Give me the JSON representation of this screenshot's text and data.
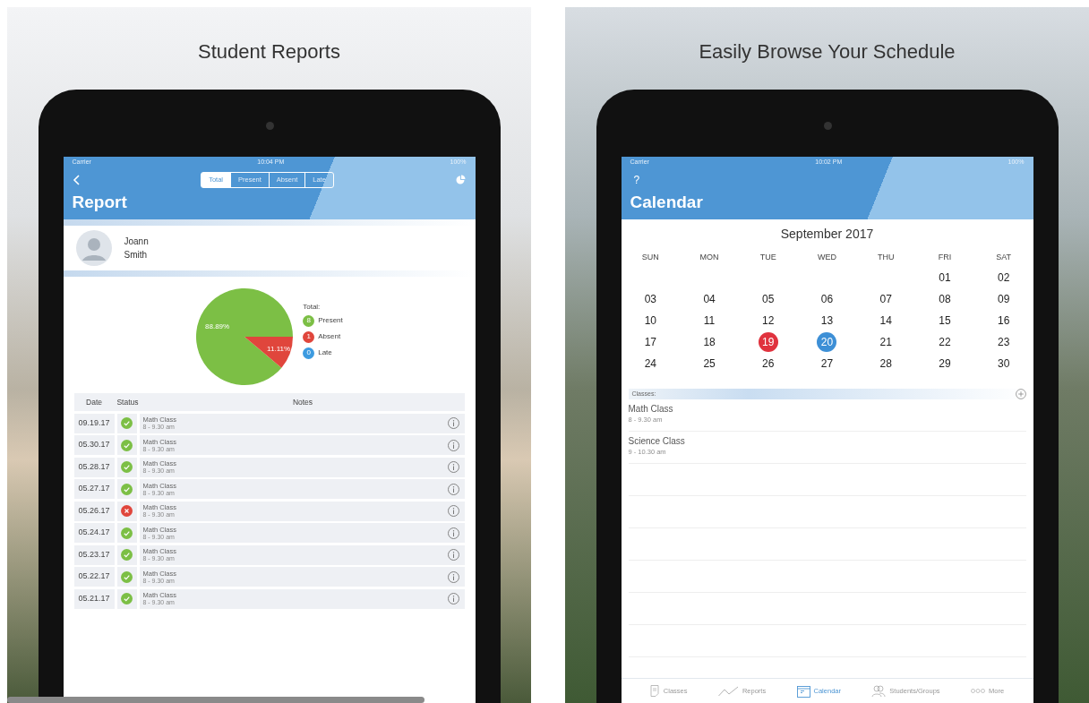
{
  "panels": [
    {
      "kind": "report",
      "headline": "Student Reports",
      "status_bar": {
        "carrier": "Carrier",
        "time": "10:04 PM",
        "battery": "100%"
      },
      "segments": [
        {
          "label": "Total",
          "selected": true
        },
        {
          "label": "Present",
          "selected": false
        },
        {
          "label": "Absent",
          "selected": false
        },
        {
          "label": "Late",
          "selected": false
        }
      ],
      "title": "Report",
      "student": {
        "first_name": "Joann",
        "last_name": "Smith"
      },
      "chart_data": {
        "type": "pie",
        "title": "Total:",
        "categories": [
          "Present",
          "Absent",
          "Late"
        ],
        "values": [
          88.89,
          11.11,
          0
        ],
        "colors": [
          "#7cbf45",
          "#e0463c",
          "#3d9be0"
        ],
        "value_labels": [
          "88.89%",
          "11.11%",
          null
        ]
      },
      "legend_counts": [
        "8",
        "1",
        "0"
      ],
      "table": {
        "columns": [
          "Date",
          "Status",
          "Notes"
        ],
        "rows": [
          {
            "date": "09.19.17",
            "kind": "present",
            "note": "Math Class",
            "time": "8 - 9.30 am"
          },
          {
            "date": "05.30.17",
            "kind": "present",
            "note": "Math Class",
            "time": "8 - 9.30 am"
          },
          {
            "date": "05.28.17",
            "kind": "present",
            "note": "Math Class",
            "time": "8 - 9.30 am"
          },
          {
            "date": "05.27.17",
            "kind": "present",
            "note": "Math Class",
            "time": "8 - 9.30 am"
          },
          {
            "date": "05.26.17",
            "kind": "absent",
            "note": "Math Class",
            "time": "8 - 9.30 am"
          },
          {
            "date": "05.24.17",
            "kind": "present",
            "note": "Math Class",
            "time": "8 - 9.30 am"
          },
          {
            "date": "05.23.17",
            "kind": "present",
            "note": "Math Class",
            "time": "8 - 9.30 am"
          },
          {
            "date": "05.22.17",
            "kind": "present",
            "note": "Math Class",
            "time": "8 - 9.30 am"
          },
          {
            "date": "05.21.17",
            "kind": "present",
            "note": "Math Class",
            "time": "8 - 9.30 am"
          }
        ]
      }
    },
    {
      "kind": "calendar",
      "headline": "Easily Browse Your Schedule",
      "status_bar": {
        "carrier": "Carrier",
        "time": "10:02 PM",
        "battery": "100%"
      },
      "help_button": "?",
      "title": "Calendar",
      "month": "September 2017",
      "weekdays": [
        "SUN",
        "MON",
        "TUE",
        "WED",
        "THU",
        "FRI",
        "SAT"
      ],
      "weeks": [
        [
          {
            "day": "01",
            "today": false,
            "selected": false
          },
          {
            "day": "02",
            "today": false,
            "selected": false
          }
        ],
        [
          {
            "day": "03",
            "today": false,
            "selected": false
          },
          {
            "day": "04",
            "today": false,
            "selected": false
          },
          {
            "day": "05",
            "today": false,
            "selected": false
          },
          {
            "day": "06",
            "today": false,
            "selected": false
          },
          {
            "day": "07",
            "today": false,
            "selected": false
          },
          {
            "day": "08",
            "today": false,
            "selected": false
          },
          {
            "day": "09",
            "today": false,
            "selected": false
          }
        ],
        [
          {
            "day": "10",
            "today": false,
            "selected": false
          },
          {
            "day": "11",
            "today": false,
            "selected": false
          },
          {
            "day": "12",
            "today": false,
            "selected": false
          },
          {
            "day": "13",
            "today": false,
            "selected": false
          },
          {
            "day": "14",
            "today": false,
            "selected": false
          },
          {
            "day": "15",
            "today": false,
            "selected": false
          },
          {
            "day": "16",
            "today": false,
            "selected": false
          }
        ],
        [
          {
            "day": "17",
            "today": false,
            "selected": false
          },
          {
            "day": "18",
            "today": false,
            "selected": false
          },
          {
            "day": "19",
            "today": true,
            "selected": false
          },
          {
            "day": "20",
            "today": false,
            "selected": true
          },
          {
            "day": "21",
            "today": false,
            "selected": false
          },
          {
            "day": "22",
            "today": false,
            "selected": false
          },
          {
            "day": "23",
            "today": false,
            "selected": false
          }
        ],
        [
          {
            "day": "24",
            "today": false,
            "selected": false
          },
          {
            "day": "25",
            "today": false,
            "selected": false
          },
          {
            "day": "26",
            "today": false,
            "selected": false
          },
          {
            "day": "27",
            "today": false,
            "selected": false
          },
          {
            "day": "28",
            "today": false,
            "selected": false
          },
          {
            "day": "29",
            "today": false,
            "selected": false
          },
          {
            "day": "30",
            "today": false,
            "selected": false
          }
        ]
      ],
      "classes_label": "Classes:",
      "classes": [
        {
          "name": "Math Class",
          "time": "8 - 9.30 am"
        },
        {
          "name": "Science Class",
          "time": "9 - 10.30 am"
        }
      ],
      "tab_bar": [
        {
          "label": "Classes",
          "selected": false
        },
        {
          "label": "Reports",
          "selected": false
        },
        {
          "label": "Calendar",
          "selected": true
        },
        {
          "label": "Students/Groups",
          "selected": false
        },
        {
          "label": "More",
          "selected": false
        }
      ]
    }
  ]
}
